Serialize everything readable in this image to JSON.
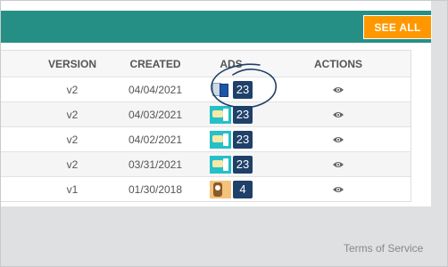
{
  "header": {
    "see_all_label": "SEE ALL",
    "accent_color": "#268f85",
    "button_color": "#ff9800"
  },
  "table": {
    "columns": [
      "VERSION",
      "CREATED",
      "ADS",
      "ACTIONS"
    ],
    "rows": [
      {
        "version": "v2",
        "created": "04/04/2021",
        "ads_count": "23",
        "thumbnail": "documents-thumbnail",
        "action_icon": "eye-icon"
      },
      {
        "version": "v2",
        "created": "04/03/2021",
        "ads_count": "23",
        "thumbnail": "teal-ad-thumbnail",
        "action_icon": "eye-icon"
      },
      {
        "version": "v2",
        "created": "04/02/2021",
        "ads_count": "23",
        "thumbnail": "teal-ad-thumbnail",
        "action_icon": "eye-icon"
      },
      {
        "version": "v2",
        "created": "03/31/2021",
        "ads_count": "23",
        "thumbnail": "teal-ad-thumbnail",
        "action_icon": "eye-icon"
      },
      {
        "version": "v1",
        "created": "01/30/2018",
        "ads_count": "4",
        "thumbnail": "orange-ad-thumbnail",
        "action_icon": "eye-icon"
      }
    ],
    "badge_color": "#1f4068",
    "annotation": "hand-drawn-circle-around-first-ads-count"
  },
  "footer": {
    "terms_label": "Terms of Service"
  }
}
